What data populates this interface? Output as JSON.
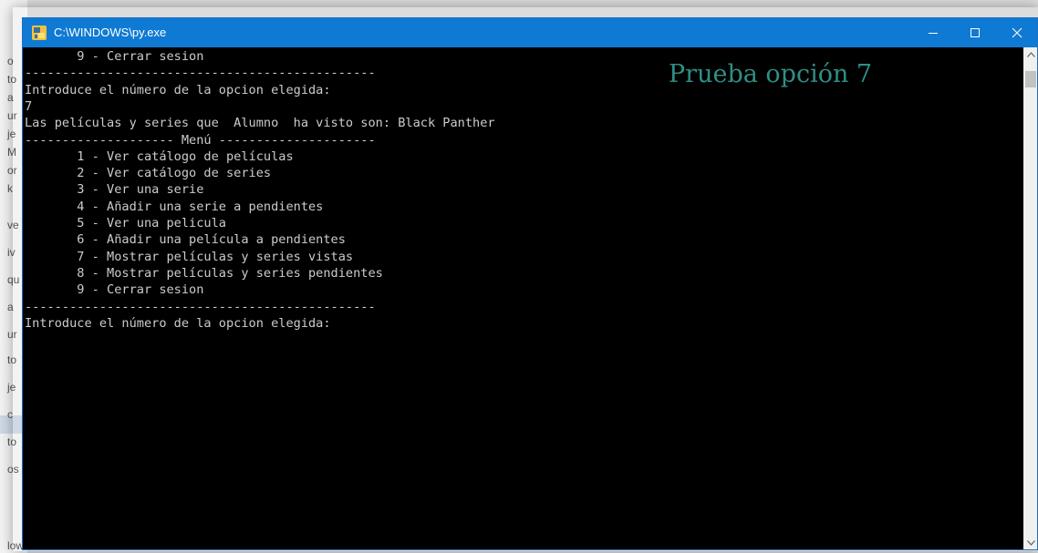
{
  "window": {
    "title": "C:\\WINDOWS\\py.exe",
    "icon": "python-launcher-icon",
    "controls": {
      "minimize": "minimize-icon",
      "maximize": "maximize-icon",
      "close": "close-icon"
    },
    "titlebar_color": "#0f7ad3"
  },
  "annotation": {
    "text": "Prueba opción 7",
    "color": "#2f8f85"
  },
  "console": {
    "text_color": "#cccccc",
    "background": "#000000",
    "lines": [
      "       9 - Cerrar sesion",
      "-----------------------------------------------",
      "Introduce el número de la opcion elegida:",
      "7",
      "Las películas y series que  Alumno  ha visto son: Black Panther",
      "-------------------- Menú ---------------------",
      "       1 - Ver catálogo de películas",
      "       2 - Ver catálogo de series",
      "       3 - Ver una serie",
      "       4 - Añadir una serie a pendientes",
      "       5 - Ver una pelicula",
      "       6 - Añadir una película a pendientes",
      "       7 - Mostrar películas y series vistas",
      "       8 - Mostrar películas y series pendientes",
      "       9 - Cerrar sesion",
      "-----------------------------------------------",
      "Introduce el número de la opcion elegida:"
    ]
  },
  "background_window": {
    "fragments": [
      "o",
      "to",
      "a",
      "ur",
      "je",
      "M",
      "or",
      "k",
      "ve",
      "iv",
      "qu",
      "a",
      "ur",
      "to",
      "je",
      "c",
      "to",
      "os",
      "lows (C:)"
    ]
  }
}
